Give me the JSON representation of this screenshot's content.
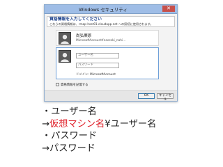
{
  "dialog": {
    "title": "Windows セキュリティ",
    "close_glyph": "✕",
    "prompt_title": "資格情報を入力してください",
    "prompt_subtitle": "これらの資格情報は、rmap-host01.cloudapp.net への接続に使用されます。",
    "saved_user": {
      "name": "尚弘栗原",
      "domain": "MicrosoftAccount¥naoraki_nahi..."
    },
    "new_user": {
      "username_placeholder": "ユーザー名",
      "password_placeholder": "パスワード",
      "domain_text": "ドメイン: MicrosoftAccount"
    },
    "remember_label": "資格情報を記憶する",
    "ok_label": "OK",
    "cancel_label": "キャンセル",
    "icons": [
      "user-silhouette-icon",
      "close-icon",
      "checkbox-icon"
    ]
  },
  "notes": {
    "line1": "・ユーザー名",
    "line2_prefix": "→",
    "line2_highlight": "仮想マシン名",
    "line2_suffix": "¥ユーザー名",
    "line3": "・パスワード",
    "line4": "→パスワード",
    "highlight_color": "#e0202a"
  }
}
